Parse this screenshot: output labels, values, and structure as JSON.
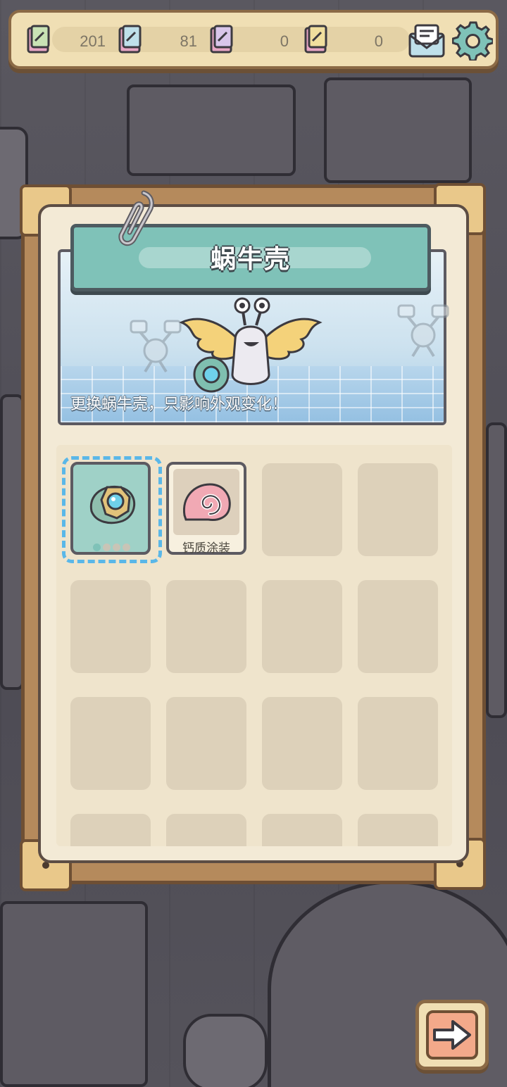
{
  "resources": [
    {
      "icon": "pink-ticket-icon",
      "value": "201"
    },
    {
      "icon": "pink-ticket-icon",
      "value": "81"
    },
    {
      "icon": "pink-ticket-icon",
      "value": "0"
    },
    {
      "icon": "pink-ticket-icon",
      "value": "0"
    }
  ],
  "topbar": {
    "mail_icon": "mail-icon",
    "settings_icon": "gear-icon"
  },
  "panel": {
    "title": "蜗牛壳",
    "hint": "更换蜗牛壳，只影响外观变化！"
  },
  "items": [
    {
      "name": "",
      "icon": "mech-shell-icon",
      "selected": true,
      "level_dots": 4,
      "level_on": 1
    },
    {
      "name": "钙质涂装",
      "icon": "pink-spiral-shell-icon",
      "selected": false
    }
  ],
  "empty_slots": 14,
  "colors": {
    "accent": "#7fc2b8",
    "panel": "#f3ead6",
    "frame": "#b58a5c",
    "select": "#5ab7e8"
  },
  "next_button": {
    "icon": "arrow-right-icon"
  }
}
